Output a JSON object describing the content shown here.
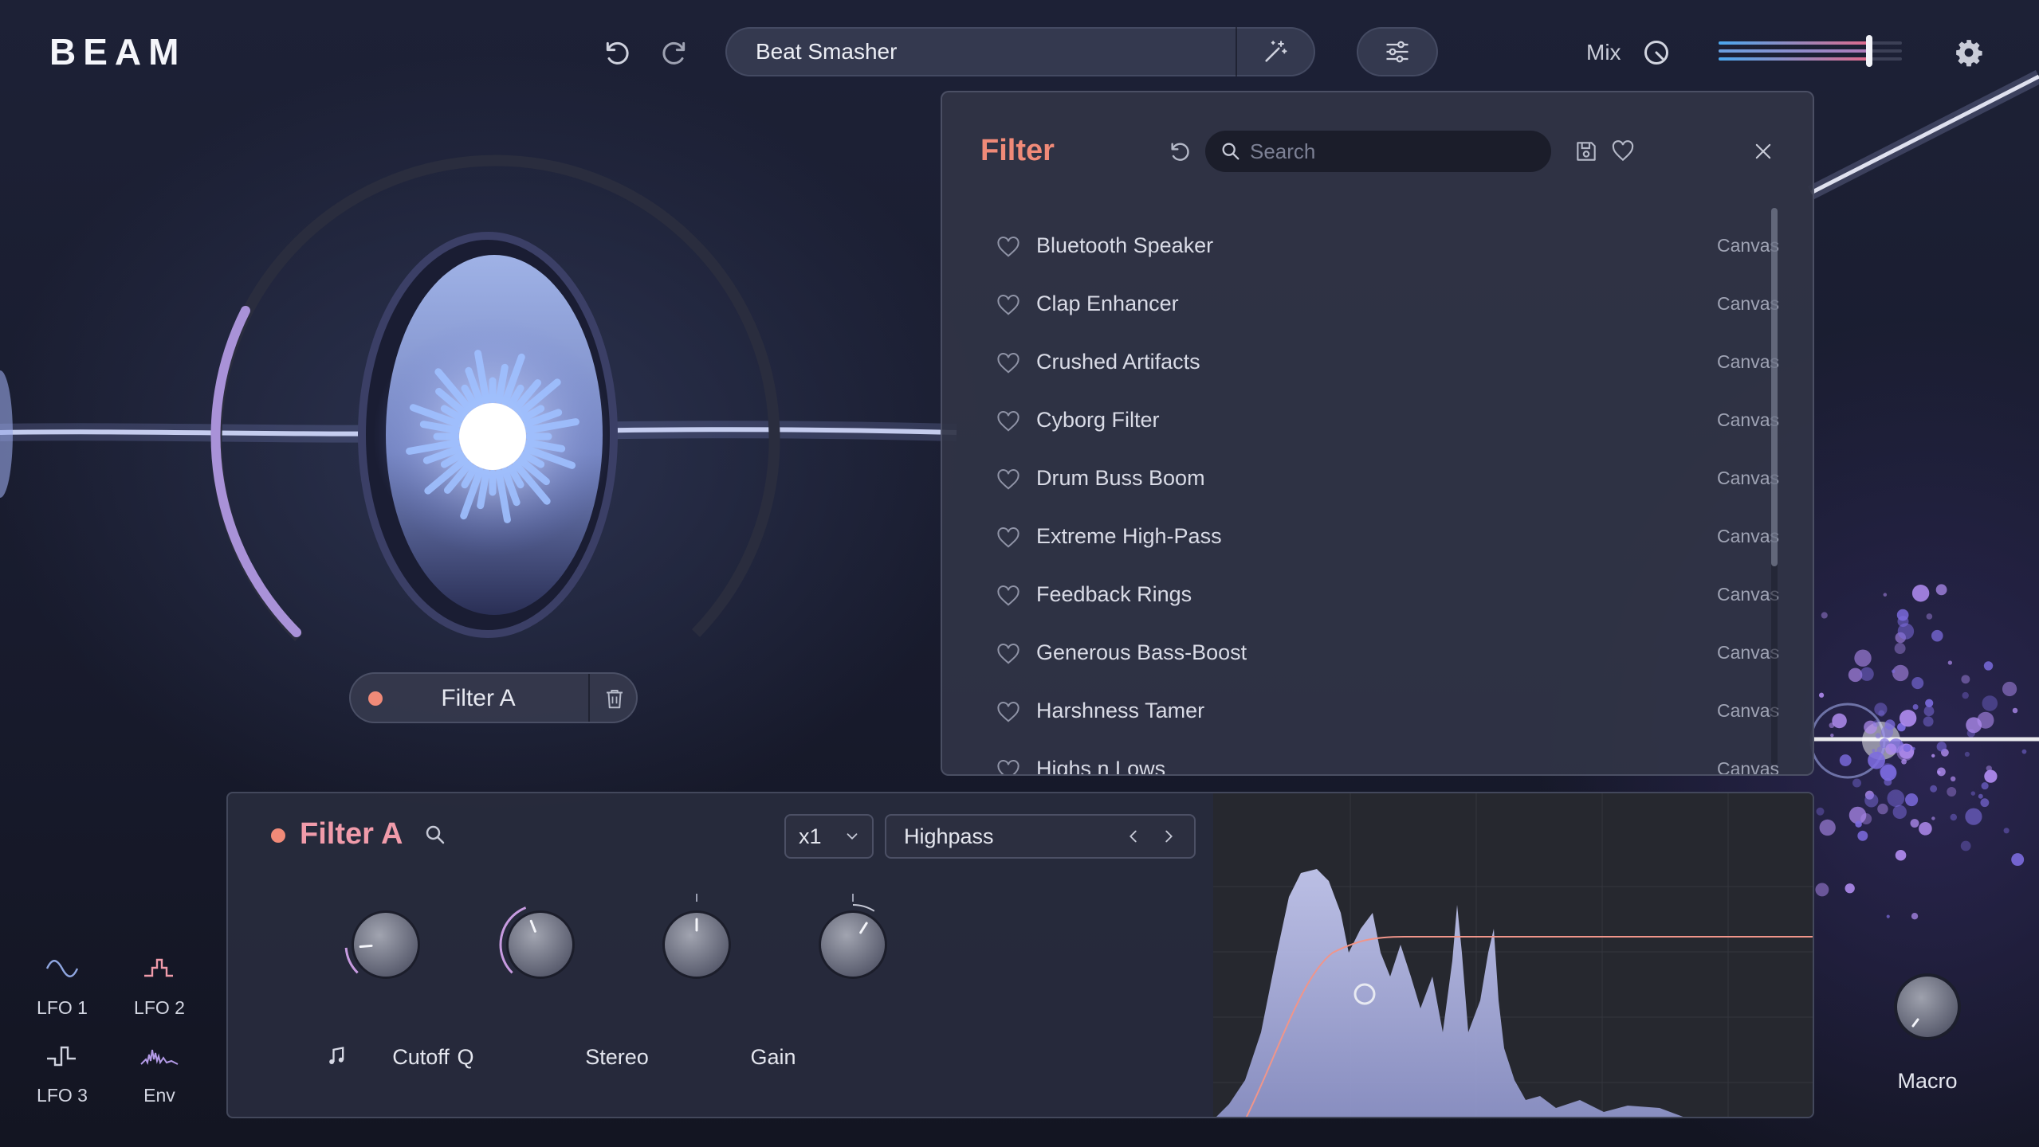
{
  "app": {
    "name": "BEAM"
  },
  "header": {
    "preset_name": "Beat Smasher",
    "mix_label": "Mix",
    "mix_level": 0.82
  },
  "module_chip": {
    "label": "Filter A"
  },
  "browser": {
    "title": "Filter",
    "search_placeholder": "Search",
    "items": [
      {
        "name": "Bluetooth Speaker",
        "source": "Canvas"
      },
      {
        "name": "Clap Enhancer",
        "source": "Canvas"
      },
      {
        "name": "Crushed Artifacts",
        "source": "Canvas"
      },
      {
        "name": "Cyborg Filter",
        "source": "Canvas"
      },
      {
        "name": "Drum Buss Boom",
        "source": "Canvas"
      },
      {
        "name": "Extreme High-Pass",
        "source": "Canvas"
      },
      {
        "name": "Feedback Rings",
        "source": "Canvas"
      },
      {
        "name": "Generous Bass-Boost",
        "source": "Canvas"
      },
      {
        "name": "Harshness Tamer",
        "source": "Canvas"
      },
      {
        "name": "Highs n Lows",
        "source": "Canvas"
      }
    ]
  },
  "panel": {
    "title": "Filter A",
    "multiplier": "x1",
    "filter_type": "Highpass",
    "knobs": [
      {
        "label": "Cutoff",
        "value": 0.15
      },
      {
        "label": "Q",
        "value": 0.42
      },
      {
        "label": "Stereo",
        "value": 0.5
      },
      {
        "label": "Gain",
        "value": 0.62
      }
    ]
  },
  "modulators": [
    {
      "label": "LFO 1"
    },
    {
      "label": "LFO 2"
    },
    {
      "label": "LFO 3"
    },
    {
      "label": "Env"
    }
  ],
  "macro": {
    "label": "Macro"
  },
  "colors": {
    "accent_salmon": "#f08a78",
    "accent_pink": "#f09baa",
    "mix_bar_blue": "#5ab0f0",
    "mix_bar_pink": "#e06a8c"
  }
}
